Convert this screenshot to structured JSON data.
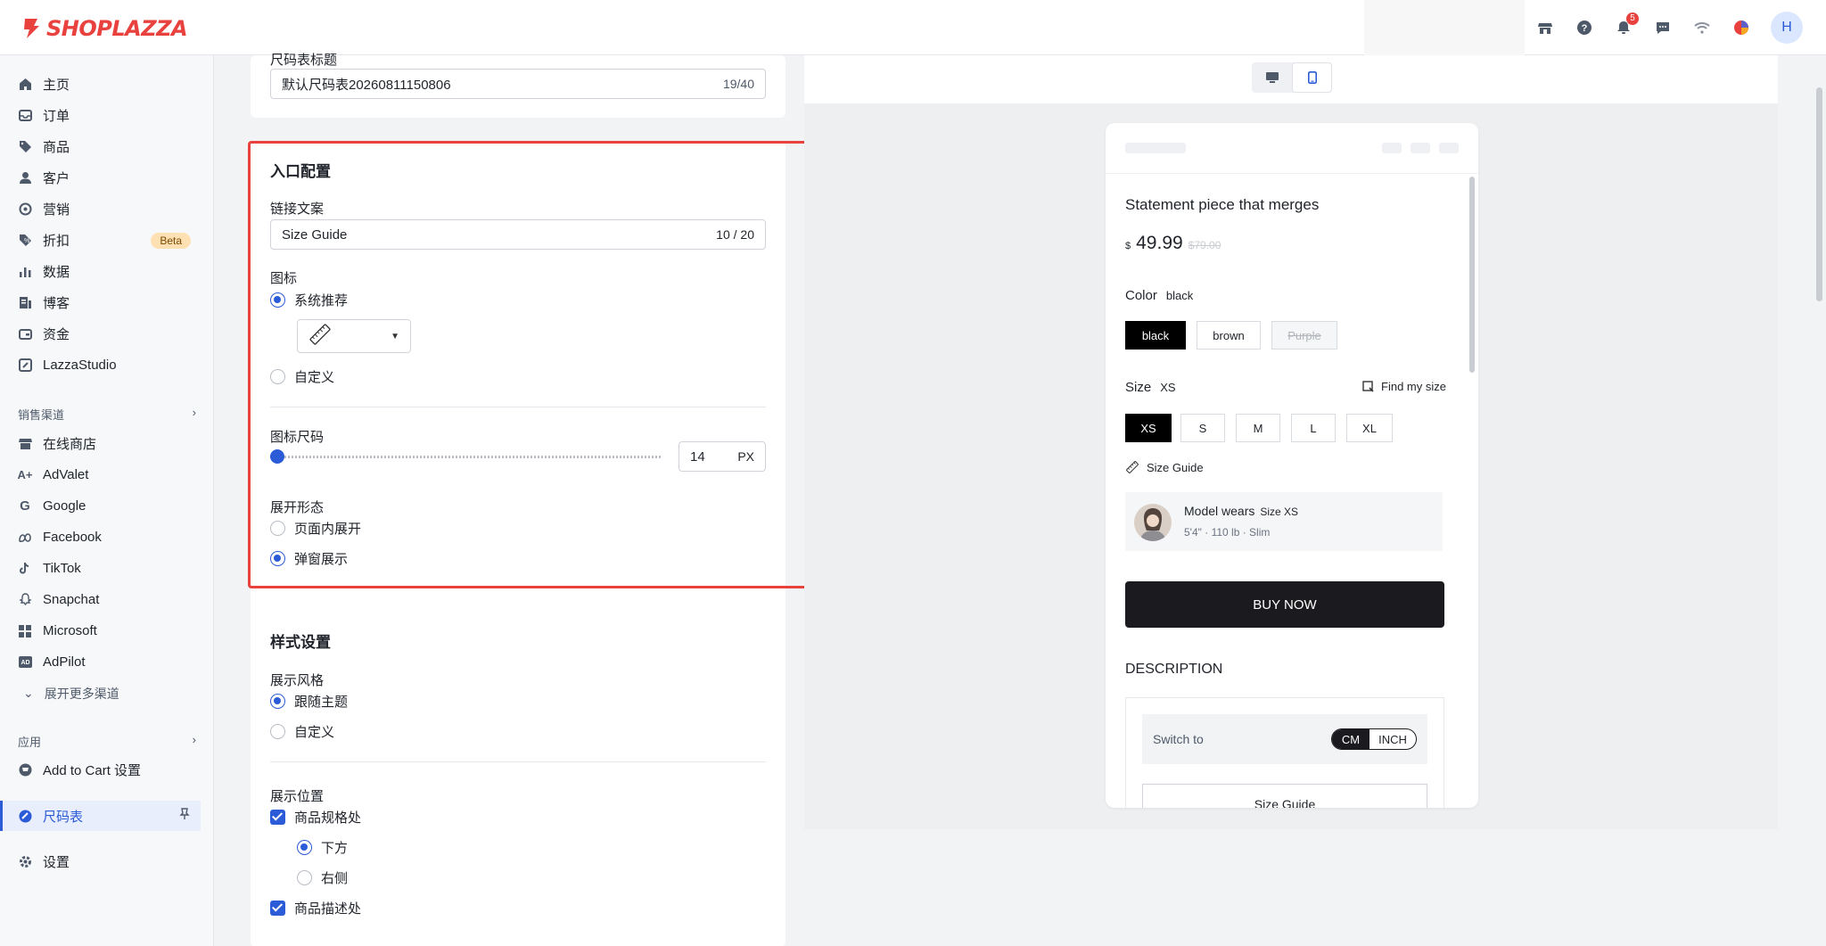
{
  "brand": {
    "name": "SHOPLAZZA",
    "color": "#e8413e"
  },
  "header": {
    "icons": [
      "store-icon",
      "help-icon",
      "bell-icon",
      "chat-icon",
      "wifi-icon",
      "app-icon"
    ],
    "notifications": "5",
    "avatar_letter": "H"
  },
  "sidebar": {
    "items": [
      {
        "label": "主页",
        "icon": "home-icon"
      },
      {
        "label": "订单",
        "icon": "inbox-icon"
      },
      {
        "label": "商品",
        "icon": "tag-icon"
      },
      {
        "label": "客户",
        "icon": "user-icon"
      },
      {
        "label": "营销",
        "icon": "marketing-icon"
      },
      {
        "label": "折扣",
        "icon": "discount-icon",
        "badge": "Beta"
      },
      {
        "label": "数据",
        "icon": "chart-icon"
      },
      {
        "label": "博客",
        "icon": "blog-icon"
      },
      {
        "label": "资金",
        "icon": "wallet-icon"
      },
      {
        "label": "LazzaStudio",
        "icon": "studio-icon"
      }
    ],
    "sales_channels_title": "销售渠道",
    "channels": [
      {
        "label": "在线商店",
        "icon": "store-icon"
      },
      {
        "label": "AdValet",
        "icon": "advalet-icon"
      },
      {
        "label": "Google",
        "icon": "google-icon"
      },
      {
        "label": "Facebook",
        "icon": "meta-icon"
      },
      {
        "label": "TikTok",
        "icon": "tiktok-icon"
      },
      {
        "label": "Snapchat",
        "icon": "snapchat-icon"
      },
      {
        "label": "Microsoft",
        "icon": "microsoft-icon"
      },
      {
        "label": "AdPilot",
        "icon": "adpilot-icon"
      }
    ],
    "more_channels": "展开更多渠道",
    "apps_title": "应用",
    "apps": [
      {
        "label": "Add to Cart 设置",
        "icon": "cart-app-icon"
      },
      {
        "label": "尺码表",
        "icon": "ruler-app-icon",
        "active": true
      }
    ],
    "settings": "设置"
  },
  "editor": {
    "title_field": {
      "label": "尺码表标题",
      "value": "默认尺码表20260811150806",
      "counter": "19/40"
    },
    "entry": {
      "title": "入口配置",
      "link_label": "链接文案",
      "link_value": "Size Guide",
      "link_counter": "10 / 20",
      "icon_label": "图标",
      "icon_opt_recommend": "系统推荐",
      "icon_opt_custom": "自定义",
      "icon_size_label": "图标尺码",
      "icon_size_value": "14",
      "icon_size_unit": "PX",
      "icon_size_fraction": 0.0,
      "expand_label": "展开形态",
      "expand_inline": "页面内展开",
      "expand_popup": "弹窗展示"
    },
    "style": {
      "title": "样式设置",
      "display_style_label": "展示风格",
      "follow_theme": "跟随主题",
      "custom": "自定义",
      "position_label": "展示位置",
      "pos_spec": "商品规格处",
      "pos_below": "下方",
      "pos_right": "右侧",
      "pos_desc": "商品描述处"
    }
  },
  "preview": {
    "product_title": "Statement piece that merges",
    "currency": "$",
    "price": "49.99",
    "compare_price": "$79.00",
    "color_label": "Color",
    "color_selected": "black",
    "colors": [
      "black",
      "brown",
      "Purple"
    ],
    "size_label": "Size",
    "size_selected": "XS",
    "find_size": "Find my size",
    "sizes": [
      "XS",
      "S",
      "M",
      "L",
      "XL"
    ],
    "size_guide": "Size Guide",
    "model_wears": "Model wears",
    "model_size": "Size XS",
    "model_stats": "5'4\" · 110 lb · Slim",
    "buy_now": "BUY NOW",
    "description": "DESCRIPTION",
    "switch_to": "Switch to",
    "unit_cm": "CM",
    "unit_inch": "INCH",
    "size_guide_btn": "Size Guide"
  }
}
